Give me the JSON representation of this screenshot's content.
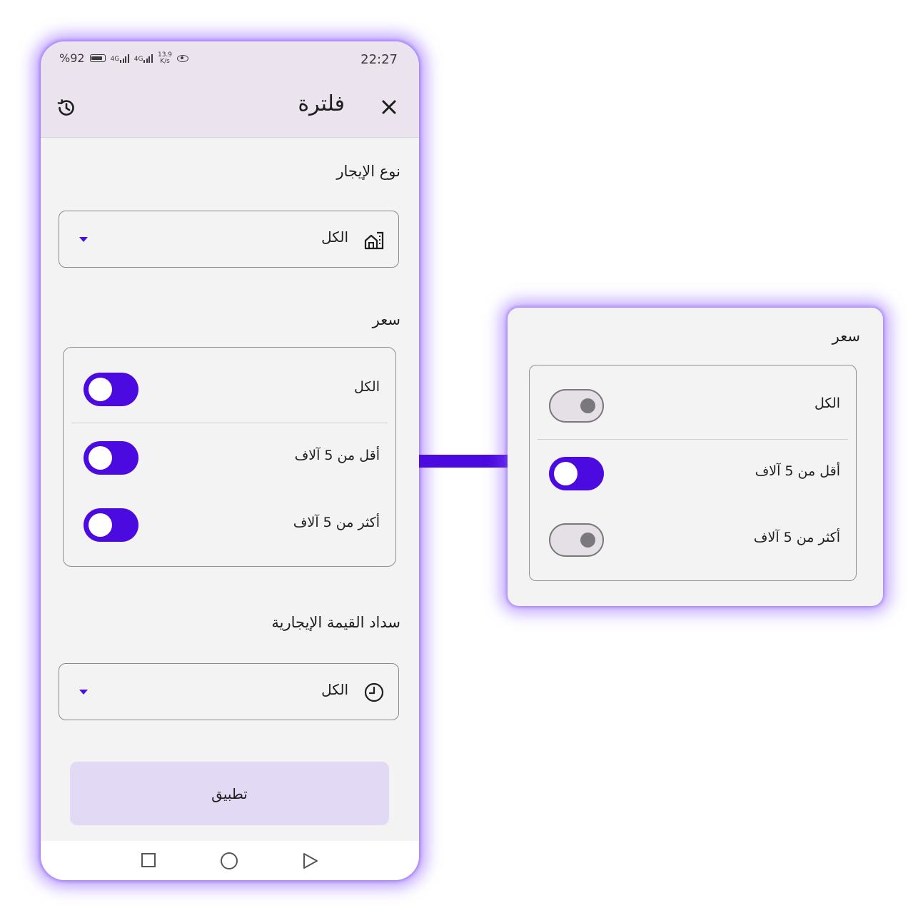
{
  "status_bar": {
    "battery_text": "%92",
    "net1": "4G",
    "net2": "4G",
    "speed_value": "13.9",
    "speed_unit": "K/s",
    "time": "22:27"
  },
  "app_bar": {
    "title": "فلترة"
  },
  "rental_type": {
    "label": "نوع الإيجار",
    "selected": "الكل"
  },
  "price": {
    "label": "سعر",
    "options": [
      {
        "label": "الكل",
        "on": true
      },
      {
        "label": "أقل من 5 آلاف",
        "on": true
      },
      {
        "label": "أكثر من 5 آلاف",
        "on": true
      }
    ]
  },
  "payment": {
    "label": "سداد القيمة الإيجارية",
    "selected": "الكل"
  },
  "apply_button": "تطبيق",
  "zoom": {
    "label": "سعر",
    "options": [
      {
        "label": "الكل",
        "on": false
      },
      {
        "label": "أقل من 5 آلاف",
        "on": true
      },
      {
        "label": "أكثر من 5 آلاف",
        "on": false
      }
    ]
  },
  "colors": {
    "accent": "#4a0ae0",
    "app_bar": "#ebe4ef",
    "button": "#e2daf5",
    "glow": "#8956ff"
  },
  "icons": [
    "close-icon",
    "history-icon",
    "building-home-icon",
    "clock-icon",
    "dropdown-arrow-icon",
    "nav-square-icon",
    "nav-circle-icon",
    "nav-back-icon"
  ]
}
